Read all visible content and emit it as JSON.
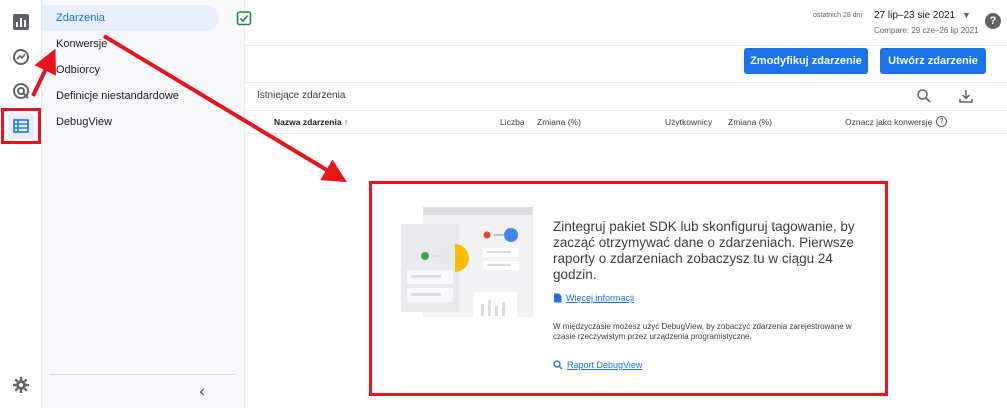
{
  "rail": {
    "items": [
      {
        "name": "reports",
        "icon": "bar-chart-icon"
      },
      {
        "name": "explore",
        "icon": "explore-icon"
      },
      {
        "name": "advertising",
        "icon": "advertising-icon"
      },
      {
        "name": "configure",
        "icon": "table-list-icon"
      }
    ],
    "settings_icon": "gear-icon"
  },
  "nav": {
    "items": [
      {
        "label": "Zdarzenia",
        "active": true
      },
      {
        "label": "Konwersje"
      },
      {
        "label": "Odbiorcy"
      },
      {
        "label": "Definicje niestandardowe"
      },
      {
        "label": "DebugView"
      }
    ],
    "collapse_icon": "chevron-left-icon"
  },
  "header": {
    "date_small": "ostatnich 28 dni",
    "date_range": "27 lip–23 sie 2021",
    "compare": "Compare: 29 cze–26 lip 2021"
  },
  "actions": {
    "modify": "Zmodyfikuj zdarzenie",
    "create": "Utwórz zdarzenie"
  },
  "table": {
    "title": "Istniejące zdarzenia",
    "columns": {
      "name": "Nazwa zdarzenia ↑",
      "count": "Liczba",
      "change1": "Zmiana (%)",
      "users": "Użytkownicy",
      "change2": "Zmiana (%)",
      "conversion": "Oznacz jako konwersję"
    }
  },
  "empty_state": {
    "heading": "Zintegruj pakiet SDK lub skonfiguruj tagowanie, by zacząć otrzymywać dane o zdarzeniach. Pierwsze raporty o zdarzeniach zobaczysz tu w ciągu 24 godzin.",
    "learn_more": "Więcej informacji",
    "meanwhile": "W międzyczasie możesz użyć DebugView, by zobaczyć zdarzenia zarejestrowane w czasie rzeczywistym przez urządzenia programistyczne.",
    "debug_link": "Raport DebugView"
  },
  "colors": {
    "accent": "#1a73e8",
    "annotation_red": "#e8141b"
  }
}
